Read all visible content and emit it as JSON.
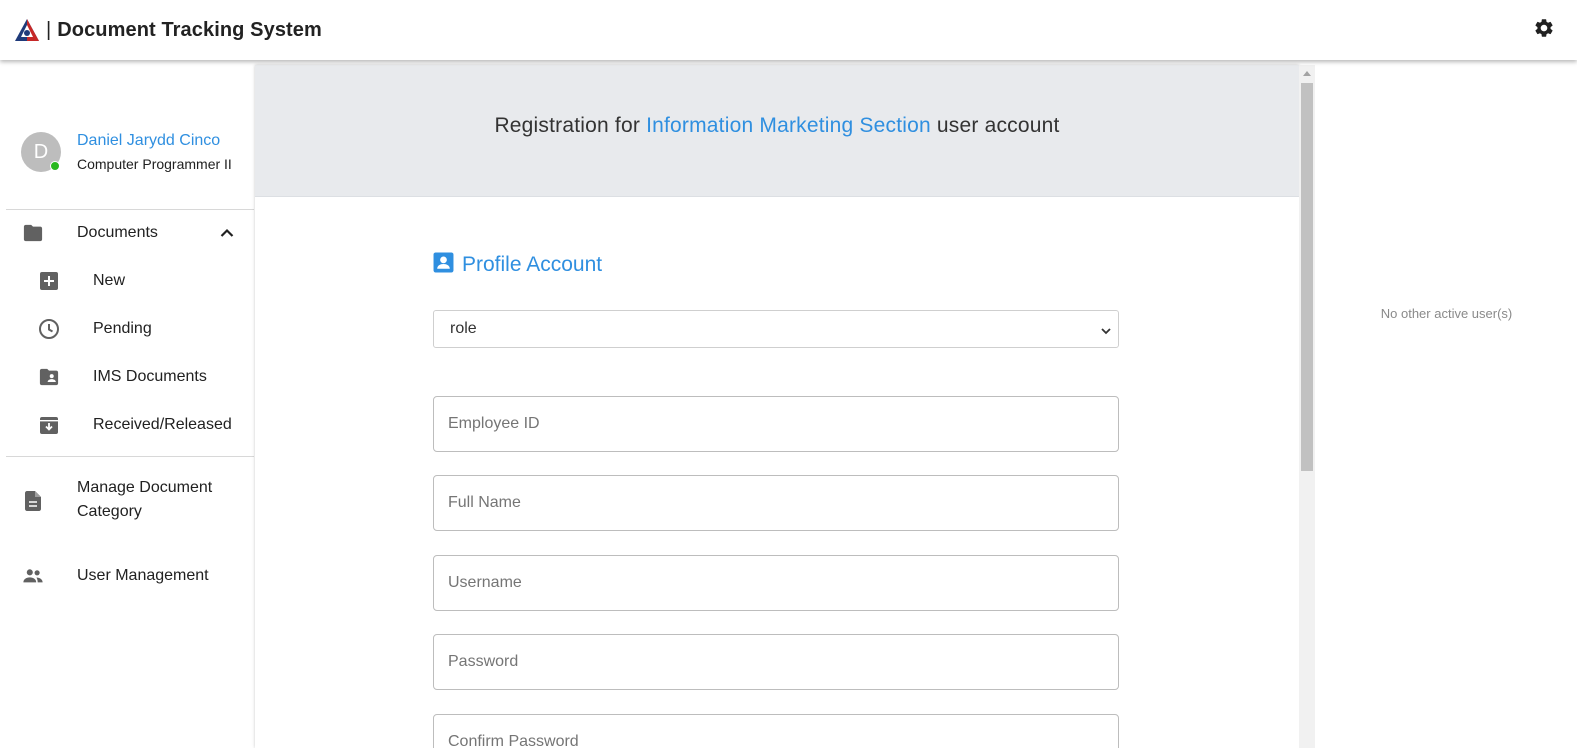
{
  "app": {
    "title": "Document Tracking System",
    "separator": "|"
  },
  "profile": {
    "avatar_initial": "D",
    "name": "Daniel Jarydd Cinco",
    "role": "Computer Programmer II",
    "status_color": "#29b81e"
  },
  "sidebar": {
    "documents": {
      "label": "Documents",
      "expanded": true,
      "children": [
        {
          "label": "New",
          "icon": "plus-box-icon"
        },
        {
          "label": "Pending",
          "icon": "clock-icon"
        },
        {
          "label": "IMS Documents",
          "icon": "folder-shared-icon"
        },
        {
          "label": "Received/Released",
          "icon": "archive-icon"
        }
      ]
    },
    "manage_category": {
      "label_line1": "Manage Document",
      "label_line2": "Category"
    },
    "user_management": {
      "label": "User Management"
    }
  },
  "banner": {
    "prefix": "Registration for",
    "highlight": "Information Marketing Section",
    "suffix": "user account"
  },
  "form": {
    "section_title": "Profile Account",
    "role_select": {
      "selected": "role"
    },
    "fields": {
      "employee_id": {
        "placeholder": "Employee ID"
      },
      "full_name": {
        "placeholder": "Full Name"
      },
      "username": {
        "placeholder": "Username"
      },
      "password": {
        "placeholder": "Password"
      },
      "confirm_password": {
        "placeholder": "Confirm Password"
      }
    }
  },
  "right_panel": {
    "empty_text": "No other active user(s)"
  },
  "colors": {
    "accent": "#2f8fe0",
    "banner_bg": "#e8eaed",
    "icon_gray": "#616161"
  }
}
